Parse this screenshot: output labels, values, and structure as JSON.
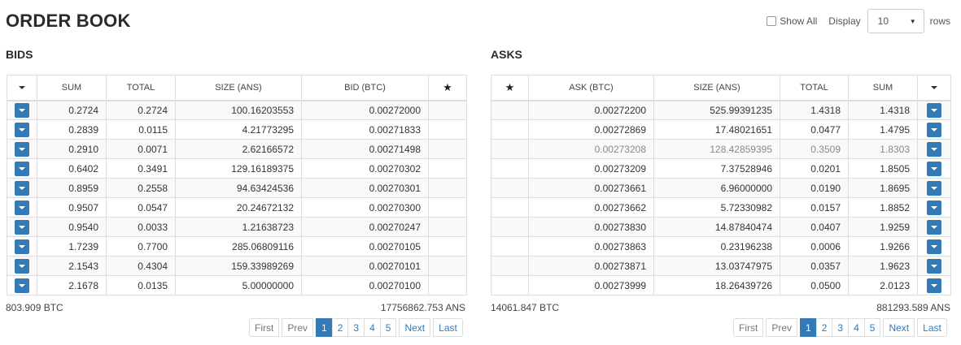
{
  "title": "ORDER BOOK",
  "controls": {
    "show_all": "Show All",
    "display": "Display",
    "rows_value": "10",
    "rows": "rows"
  },
  "bids": {
    "title": "BIDS",
    "headers": {
      "sum": "SUM",
      "total": "TOTAL",
      "size": "SIZE (ANS)",
      "price": "BID (BTC)"
    },
    "rows": [
      {
        "sum": "0.2724",
        "total": "0.2724",
        "size": "100.16203553",
        "price": "0.00272000"
      },
      {
        "sum": "0.2839",
        "total": "0.0115",
        "size": "4.21773295",
        "price": "0.00271833"
      },
      {
        "sum": "0.2910",
        "total": "0.0071",
        "size": "2.62166572",
        "price": "0.00271498"
      },
      {
        "sum": "0.6402",
        "total": "0.3491",
        "size": "129.16189375",
        "price": "0.00270302"
      },
      {
        "sum": "0.8959",
        "total": "0.2558",
        "size": "94.63424536",
        "price": "0.00270301"
      },
      {
        "sum": "0.9507",
        "total": "0.0547",
        "size": "20.24672132",
        "price": "0.00270300"
      },
      {
        "sum": "0.9540",
        "total": "0.0033",
        "size": "1.21638723",
        "price": "0.00270247"
      },
      {
        "sum": "1.7239",
        "total": "0.7700",
        "size": "285.06809116",
        "price": "0.00270105"
      },
      {
        "sum": "2.1543",
        "total": "0.4304",
        "size": "159.33989269",
        "price": "0.00270101"
      },
      {
        "sum": "2.1678",
        "total": "0.0135",
        "size": "5.00000000",
        "price": "0.00270100"
      }
    ],
    "footer_btc": "803.909 BTC",
    "footer_ans": "17756862.753 ANS"
  },
  "asks": {
    "title": "ASKS",
    "headers": {
      "price": "ASK (BTC)",
      "size": "SIZE (ANS)",
      "total": "TOTAL",
      "sum": "SUM"
    },
    "rows": [
      {
        "price": "0.00272200",
        "size": "525.99391235",
        "total": "1.4318",
        "sum": "1.4318"
      },
      {
        "price": "0.00272869",
        "size": "17.48021651",
        "total": "0.0477",
        "sum": "1.4795"
      },
      {
        "price": "0.00273208",
        "size": "128.42859395",
        "total": "0.3509",
        "sum": "1.8303"
      },
      {
        "price": "0.00273209",
        "size": "7.37528946",
        "total": "0.0201",
        "sum": "1.8505"
      },
      {
        "price": "0.00273661",
        "size": "6.96000000",
        "total": "0.0190",
        "sum": "1.8695"
      },
      {
        "price": "0.00273662",
        "size": "5.72330982",
        "total": "0.0157",
        "sum": "1.8852"
      },
      {
        "price": "0.00273830",
        "size": "14.87840474",
        "total": "0.0407",
        "sum": "1.9259"
      },
      {
        "price": "0.00273863",
        "size": "0.23196238",
        "total": "0.0006",
        "sum": "1.9266"
      },
      {
        "price": "0.00273871",
        "size": "13.03747975",
        "total": "0.0357",
        "sum": "1.9623"
      },
      {
        "price": "0.00273999",
        "size": "18.26439726",
        "total": "0.0500",
        "sum": "2.0123"
      }
    ],
    "footer_btc": "14061.847 BTC",
    "footer_ans": "881293.589 ANS"
  },
  "pagination": {
    "first": "First",
    "prev": "Prev",
    "pages": [
      "1",
      "2",
      "3",
      "4",
      "5"
    ],
    "next": "Next",
    "last": "Last"
  },
  "colors": {
    "accent": "#337ab7"
  },
  "icons": {
    "row_menu": "caret-down-icon",
    "favorite": "star-icon"
  }
}
